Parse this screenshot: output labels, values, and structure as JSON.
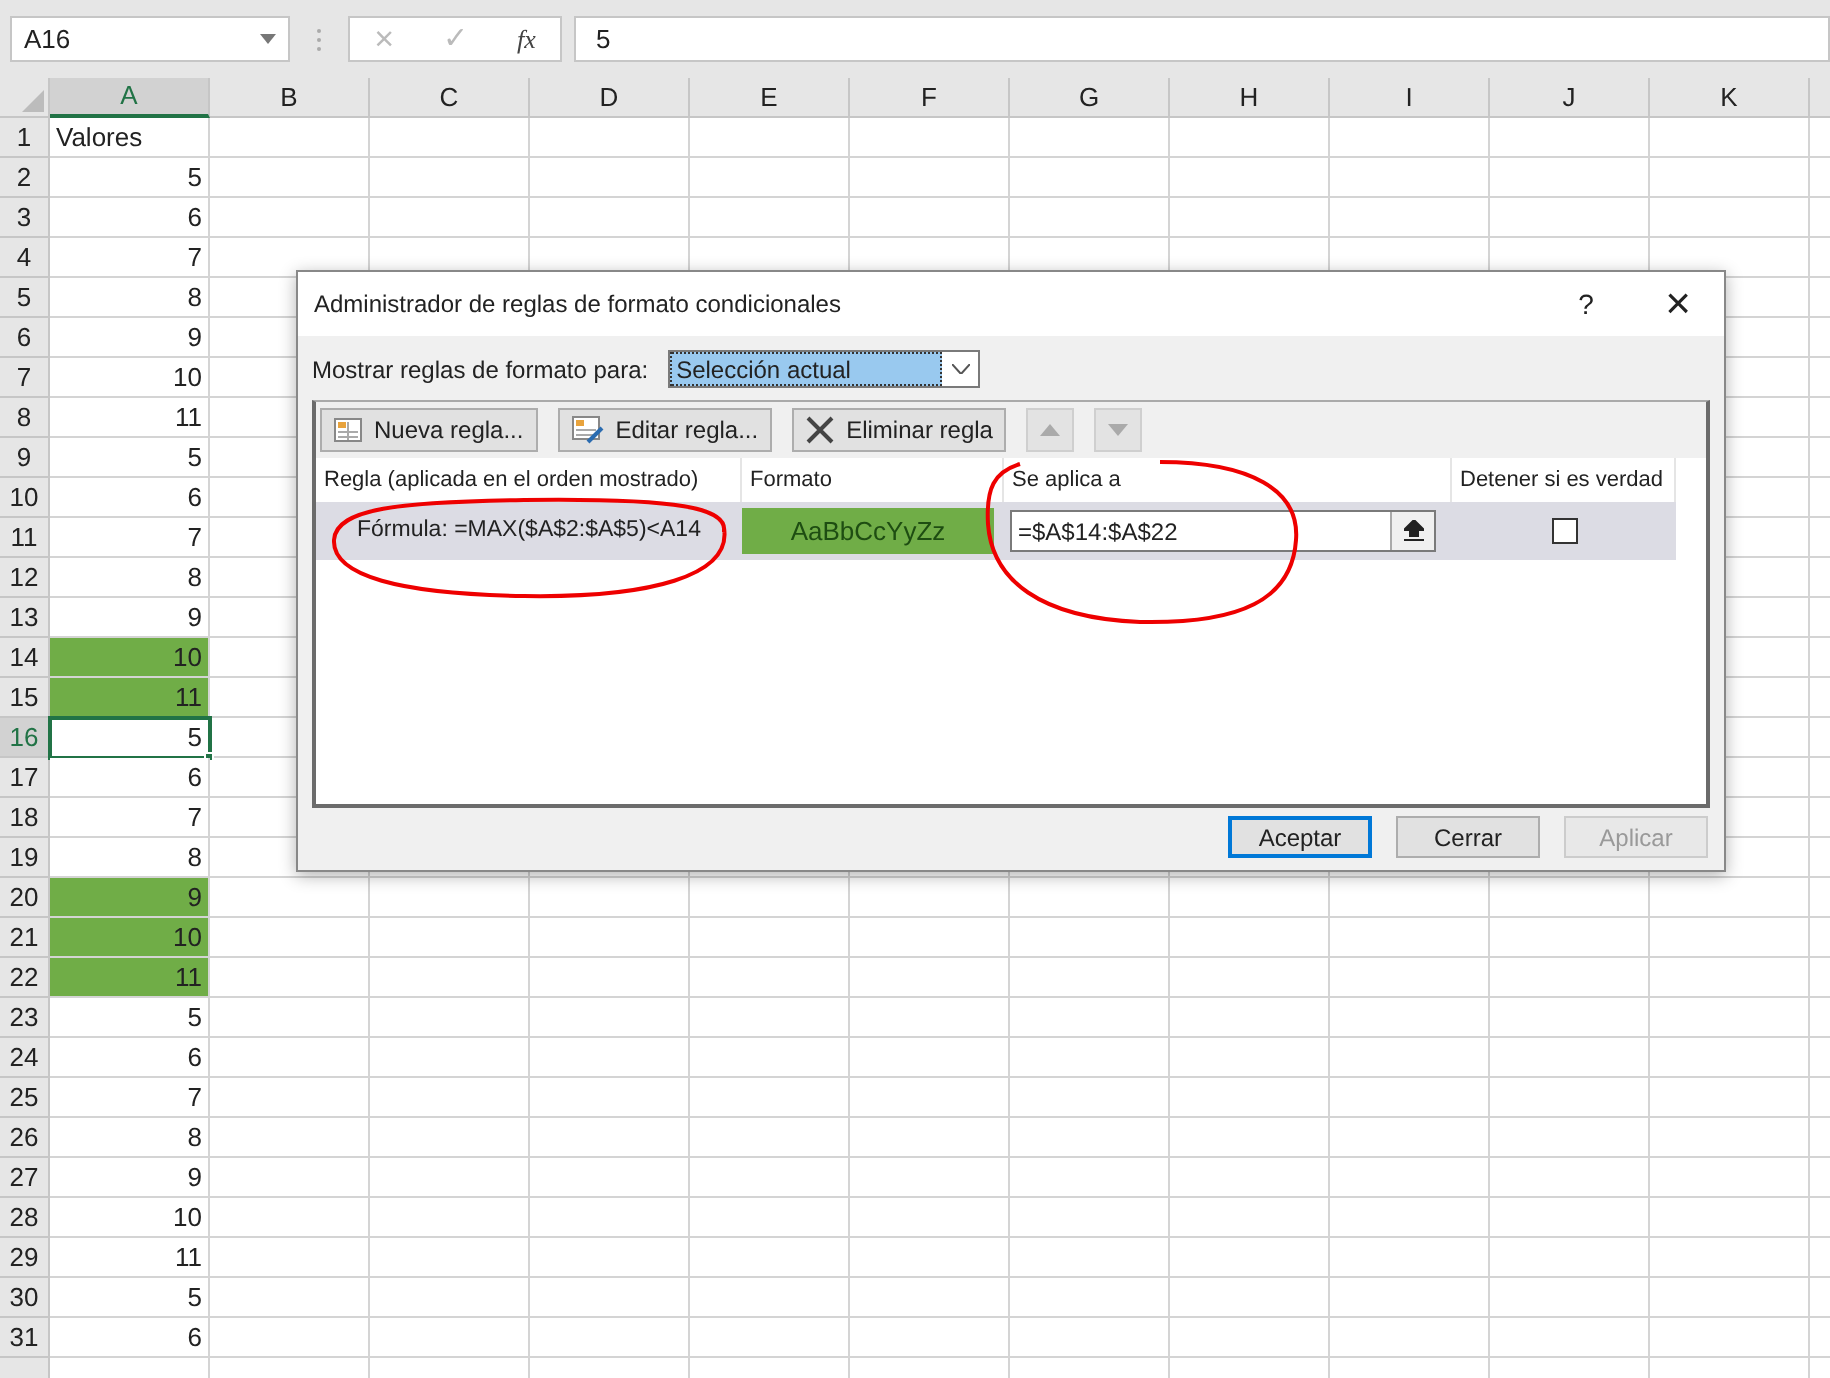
{
  "name_box": {
    "value": "A16"
  },
  "formula_bar": {
    "cancel": "×",
    "enter": "✓",
    "fx": "fx",
    "value": "5"
  },
  "columns": [
    {
      "label": "A",
      "selected": true
    },
    {
      "label": "B",
      "selected": false
    },
    {
      "label": "C",
      "selected": false
    },
    {
      "label": "D",
      "selected": false
    },
    {
      "label": "E",
      "selected": false
    },
    {
      "label": "F",
      "selected": false
    },
    {
      "label": "G",
      "selected": false
    },
    {
      "label": "H",
      "selected": false
    },
    {
      "label": "I",
      "selected": false
    },
    {
      "label": "J",
      "selected": false
    },
    {
      "label": "K",
      "selected": false
    }
  ],
  "rows": [
    {
      "header": "1",
      "value": "Valores",
      "kind": "text",
      "highlighted": false,
      "selected": false
    },
    {
      "header": "2",
      "value": "5",
      "kind": "number",
      "highlighted": false,
      "selected": false
    },
    {
      "header": "3",
      "value": "6",
      "kind": "number",
      "highlighted": false,
      "selected": false
    },
    {
      "header": "4",
      "value": "7",
      "kind": "number",
      "highlighted": false,
      "selected": false
    },
    {
      "header": "5",
      "value": "8",
      "kind": "number",
      "highlighted": false,
      "selected": false
    },
    {
      "header": "6",
      "value": "9",
      "kind": "number",
      "highlighted": false,
      "selected": false
    },
    {
      "header": "7",
      "value": "10",
      "kind": "number",
      "highlighted": false,
      "selected": false
    },
    {
      "header": "8",
      "value": "11",
      "kind": "number",
      "highlighted": false,
      "selected": false
    },
    {
      "header": "9",
      "value": "5",
      "kind": "number",
      "highlighted": false,
      "selected": false
    },
    {
      "header": "10",
      "value": "6",
      "kind": "number",
      "highlighted": false,
      "selected": false
    },
    {
      "header": "11",
      "value": "7",
      "kind": "number",
      "highlighted": false,
      "selected": false
    },
    {
      "header": "12",
      "value": "8",
      "kind": "number",
      "highlighted": false,
      "selected": false
    },
    {
      "header": "13",
      "value": "9",
      "kind": "number",
      "highlighted": false,
      "selected": false
    },
    {
      "header": "14",
      "value": "10",
      "kind": "number",
      "highlighted": true,
      "selected": false
    },
    {
      "header": "15",
      "value": "11",
      "kind": "number",
      "highlighted": true,
      "selected": false
    },
    {
      "header": "16",
      "value": "5",
      "kind": "number",
      "highlighted": false,
      "selected": true
    },
    {
      "header": "17",
      "value": "6",
      "kind": "number",
      "highlighted": false,
      "selected": false
    },
    {
      "header": "18",
      "value": "7",
      "kind": "number",
      "highlighted": false,
      "selected": false
    },
    {
      "header": "19",
      "value": "8",
      "kind": "number",
      "highlighted": false,
      "selected": false
    },
    {
      "header": "20",
      "value": "9",
      "kind": "number",
      "highlighted": true,
      "selected": false
    },
    {
      "header": "21",
      "value": "10",
      "kind": "number",
      "highlighted": true,
      "selected": false
    },
    {
      "header": "22",
      "value": "11",
      "kind": "number",
      "highlighted": true,
      "selected": false
    },
    {
      "header": "23",
      "value": "5",
      "kind": "number",
      "highlighted": false,
      "selected": false
    },
    {
      "header": "24",
      "value": "6",
      "kind": "number",
      "highlighted": false,
      "selected": false
    },
    {
      "header": "25",
      "value": "7",
      "kind": "number",
      "highlighted": false,
      "selected": false
    },
    {
      "header": "26",
      "value": "8",
      "kind": "number",
      "highlighted": false,
      "selected": false
    },
    {
      "header": "27",
      "value": "9",
      "kind": "number",
      "highlighted": false,
      "selected": false
    },
    {
      "header": "28",
      "value": "10",
      "kind": "number",
      "highlighted": false,
      "selected": false
    },
    {
      "header": "29",
      "value": "11",
      "kind": "number",
      "highlighted": false,
      "selected": false
    },
    {
      "header": "30",
      "value": "5",
      "kind": "number",
      "highlighted": false,
      "selected": false
    },
    {
      "header": "31",
      "value": "6",
      "kind": "number",
      "highlighted": false,
      "selected": false
    }
  ],
  "dialog": {
    "title": "Administrador de reglas de formato condicionales",
    "help": "?",
    "close": "×",
    "show_label": "Mostrar reglas de formato para:",
    "show_value": "Selección actual",
    "toolbar": [
      {
        "label": "Nueva regla...",
        "kind": "new",
        "disabled": false
      },
      {
        "label": "Editar regla...",
        "kind": "edit",
        "disabled": false
      },
      {
        "label": "Eliminar regla",
        "kind": "delete",
        "disabled": false
      },
      {
        "kind": "up",
        "disabled": true
      },
      {
        "kind": "down",
        "disabled": true
      }
    ],
    "table": {
      "columns": [
        "Regla (aplicada en el orden mostrado)",
        "Formato",
        "Se aplica a",
        "Detener si es verdad"
      ],
      "rows": [
        {
          "rule": "Fórmula: =MAX($A$2:$A$5)<A14",
          "preview": "AaBbCcYyZz",
          "applies_to": "=$A$14:$A$22",
          "stop_if_true": false,
          "selected": true
        }
      ]
    },
    "buttons": [
      {
        "label": "Aceptar",
        "default": true,
        "disabled": false
      },
      {
        "label": "Cerrar",
        "default": false,
        "disabled": false
      },
      {
        "label": "Aplicar",
        "default": false,
        "disabled": true
      }
    ]
  }
}
